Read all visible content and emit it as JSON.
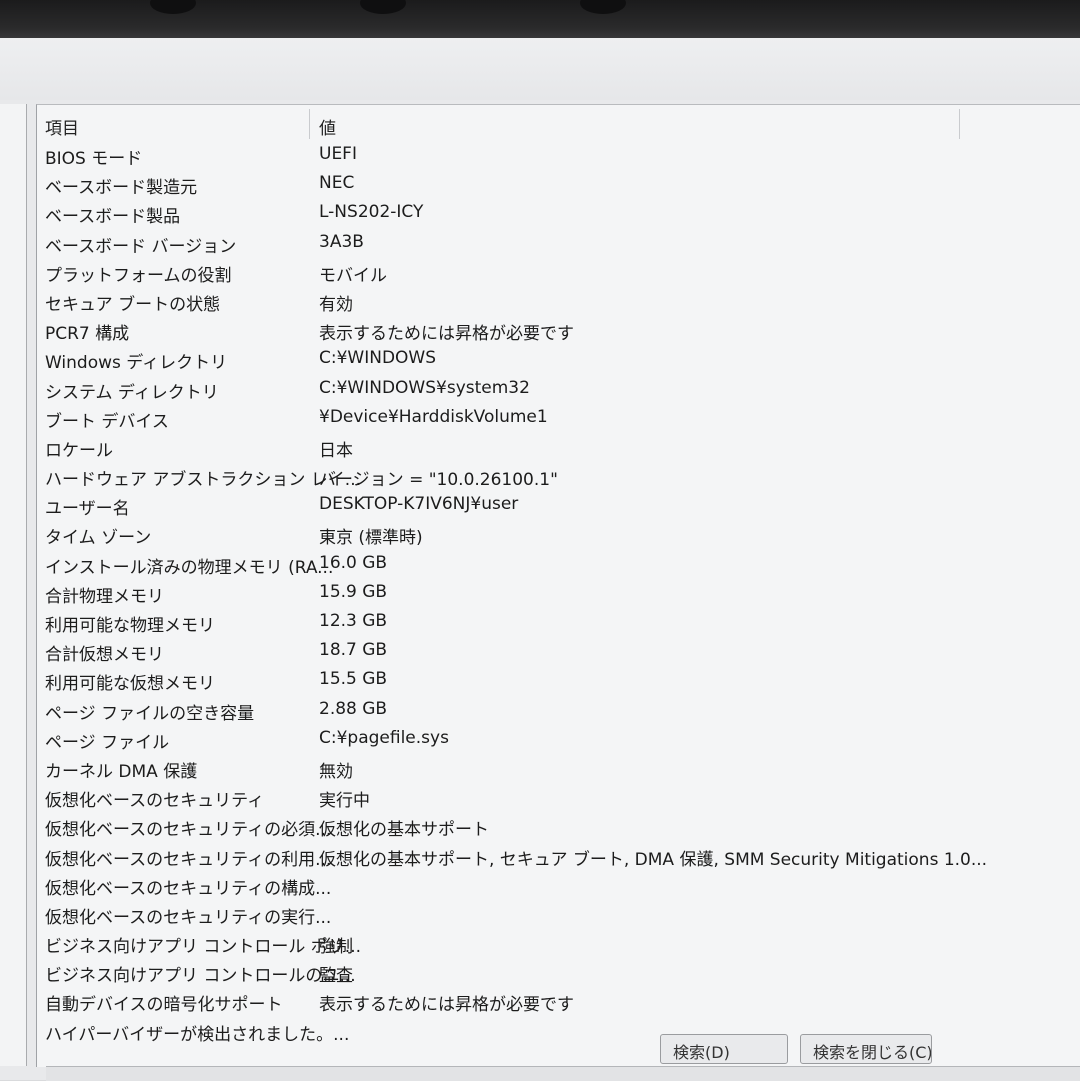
{
  "table": {
    "headers": {
      "name": "項目",
      "value": "値"
    },
    "rows": [
      {
        "name": "BIOS モード",
        "value": "UEFI"
      },
      {
        "name": "ベースボード製造元",
        "value": "NEC"
      },
      {
        "name": "ベースボード製品",
        "value": "L-NS202-ICY"
      },
      {
        "name": "ベースボード バージョン",
        "value": "3A3B"
      },
      {
        "name": "プラットフォームの役割",
        "value": "モバイル"
      },
      {
        "name": "セキュア ブートの状態",
        "value": "有効"
      },
      {
        "name": "PCR7 構成",
        "value": "表示するためには昇格が必要です"
      },
      {
        "name": "Windows ディレクトリ",
        "value": "C:¥WINDOWS"
      },
      {
        "name": "システム ディレクトリ",
        "value": "C:¥WINDOWS¥system32"
      },
      {
        "name": "ブート デバイス",
        "value": "¥Device¥HarddiskVolume1"
      },
      {
        "name": "ロケール",
        "value": "日本"
      },
      {
        "name": "ハードウェア アブストラクション レイ...",
        "value": "バージョン = \"10.0.26100.1\""
      },
      {
        "name": "ユーザー名",
        "value": "DESKTOP-K7IV6NJ¥user"
      },
      {
        "name": "タイム ゾーン",
        "value": "東京 (標準時)"
      },
      {
        "name": "インストール済みの物理メモリ (RA...",
        "value": "16.0 GB"
      },
      {
        "name": "合計物理メモリ",
        "value": "15.9 GB"
      },
      {
        "name": "利用可能な物理メモリ",
        "value": "12.3 GB"
      },
      {
        "name": "合計仮想メモリ",
        "value": "18.7 GB"
      },
      {
        "name": "利用可能な仮想メモリ",
        "value": "15.5 GB"
      },
      {
        "name": "ページ ファイルの空き容量",
        "value": "2.88 GB"
      },
      {
        "name": "ページ ファイル",
        "value": "C:¥pagefile.sys"
      },
      {
        "name": "カーネル DMA 保護",
        "value": "無効"
      },
      {
        "name": "仮想化ベースのセキュリティ",
        "value": "実行中"
      },
      {
        "name": "仮想化ベースのセキュリティの必須...",
        "value": "仮想化の基本サポート"
      },
      {
        "name": "仮想化ベースのセキュリティの利用...",
        "value": "仮想化の基本サポート, セキュア ブート, DMA 保護, SMM Security Mitigations 1.0..."
      },
      {
        "name": "仮想化ベースのセキュリティの構成...",
        "value": ""
      },
      {
        "name": "仮想化ベースのセキュリティの実行...",
        "value": ""
      },
      {
        "name": "ビジネス向けアプリ コントロール ポリ...",
        "value": "強制"
      },
      {
        "name": "ビジネス向けアプリ コントロールのユ...",
        "value": "監査"
      },
      {
        "name": "自動デバイスの暗号化サポート",
        "value": "表示するためには昇格が必要です"
      },
      {
        "name": "ハイパーバイザーが検出されました。...",
        "value": ""
      }
    ]
  },
  "buttons": {
    "find": "検索(D)",
    "close_find": "検索を閉じる(C)"
  }
}
